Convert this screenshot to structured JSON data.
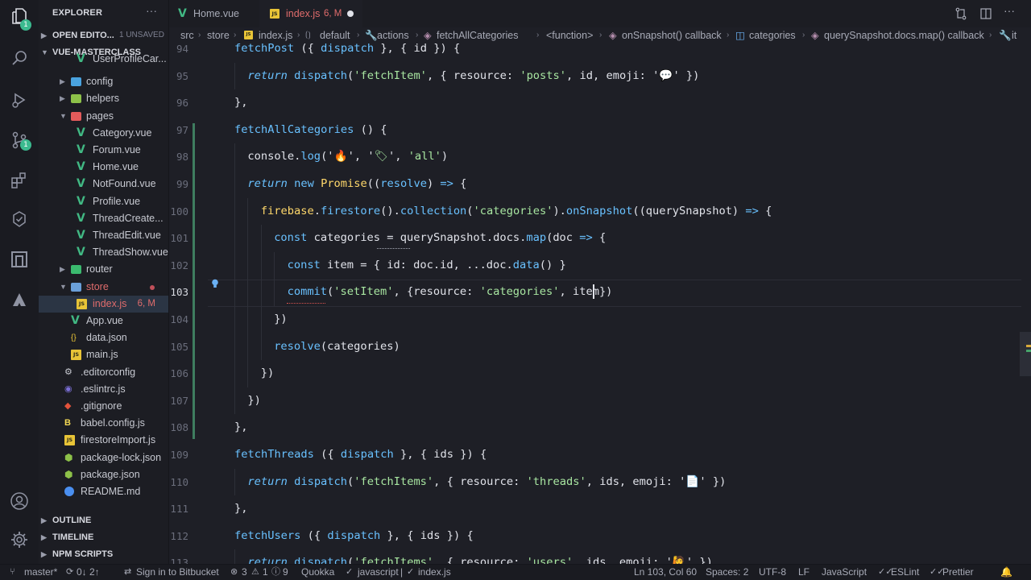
{
  "activity_bar": {
    "explorer_badge": "1",
    "scm_badge": "1"
  },
  "sidebar": {
    "title": "EXPLORER",
    "more": "···",
    "open_editors": {
      "label": "OPEN EDITO...",
      "status": "1 UNSAVED"
    },
    "project": {
      "label": "VUE-MASTERCLASS"
    },
    "tree": [
      {
        "label": "UserProfileCar...",
        "kind": "vue"
      },
      {
        "label": "config",
        "kind": "folder",
        "color": "#4aa3df"
      },
      {
        "label": "helpers",
        "kind": "folder",
        "color": "#8dc149"
      },
      {
        "label": "pages",
        "kind": "folder-open",
        "color": "#e35b5b"
      },
      {
        "label": "Category.vue",
        "kind": "vue"
      },
      {
        "label": "Forum.vue",
        "kind": "vue"
      },
      {
        "label": "Home.vue",
        "kind": "vue"
      },
      {
        "label": "NotFound.vue",
        "kind": "vue"
      },
      {
        "label": "Profile.vue",
        "kind": "vue"
      },
      {
        "label": "ThreadCreate...",
        "kind": "vue"
      },
      {
        "label": "ThreadEdit.vue",
        "kind": "vue"
      },
      {
        "label": "ThreadShow.vue",
        "kind": "vue"
      },
      {
        "label": "router",
        "kind": "folder",
        "color": "#3bba6f"
      },
      {
        "label": "store",
        "kind": "folder-open",
        "color": "#6a9fd8"
      },
      {
        "label": "index.js",
        "kind": "js",
        "status": "6, M"
      },
      {
        "label": "App.vue",
        "kind": "vue"
      },
      {
        "label": "data.json",
        "kind": "json"
      },
      {
        "label": "main.js",
        "kind": "js"
      },
      {
        "label": ".editorconfig",
        "kind": "config"
      },
      {
        "label": ".eslintrc.js",
        "kind": "eslint"
      },
      {
        "label": ".gitignore",
        "kind": "git"
      },
      {
        "label": "babel.config.js",
        "kind": "babel"
      },
      {
        "label": "firestoreImport.js",
        "kind": "js"
      },
      {
        "label": "package-lock.json",
        "kind": "npm"
      },
      {
        "label": "package.json",
        "kind": "npm"
      },
      {
        "label": "README.md",
        "kind": "info"
      }
    ],
    "sections": [
      {
        "label": "OUTLINE"
      },
      {
        "label": "TIMELINE"
      },
      {
        "label": "NPM SCRIPTS"
      }
    ]
  },
  "tabs": [
    {
      "label": "Home.vue",
      "icon": "vue"
    },
    {
      "label": "index.js",
      "icon": "js",
      "status": "6, M"
    }
  ],
  "breadcrumb": [
    "src",
    "store",
    "index.js",
    "default",
    "actions",
    "fetchAllCategories",
    "<function>",
    "onSnapshot() callback",
    "categories",
    "querySnapshot.docs.map() callback",
    "it"
  ],
  "editor": {
    "current_line": 103,
    "lines": [
      {
        "n": 94,
        "indent": 0,
        "tokens": [
          [
            "fn",
            "fetchPost"
          ],
          [
            "",
            " ({ "
          ],
          [
            "kw",
            "dispatch"
          ],
          [
            "",
            " }, { "
          ],
          [
            "prop",
            "id"
          ],
          [
            "",
            " }) {"
          ]
        ]
      },
      {
        "n": 95,
        "indent": 1,
        "tokens": [
          [
            "kwi",
            "return"
          ],
          [
            "",
            " "
          ],
          [
            "fn",
            "dispatch"
          ],
          [
            "",
            "("
          ],
          [
            "str",
            "'fetchItem'"
          ],
          [
            "",
            ", { "
          ],
          [
            "prop",
            "resource"
          ],
          [
            "",
            ": "
          ],
          [
            "str",
            "'posts'"
          ],
          [
            "",
            ", id, emoji: '"
          ],
          [
            "str",
            "💬"
          ],
          [
            "",
            "' })"
          ]
        ]
      },
      {
        "n": 96,
        "indent": 0,
        "tokens": [
          [
            "",
            "},"
          ]
        ]
      },
      {
        "n": 97,
        "indent": 0,
        "tokens": [
          [
            "fn",
            "fetchAllCategories"
          ],
          [
            "",
            " () {"
          ]
        ]
      },
      {
        "n": 98,
        "indent": 1,
        "tokens": [
          [
            "",
            "console."
          ],
          [
            "fn",
            "log"
          ],
          [
            "",
            "('"
          ],
          [
            "str",
            "🔥"
          ],
          [
            "",
            "', '"
          ],
          [
            "str",
            "🏷"
          ],
          [
            "",
            "', "
          ],
          [
            "str",
            "'all'"
          ],
          [
            "",
            ")"
          ]
        ]
      },
      {
        "n": 99,
        "indent": 1,
        "tokens": [
          [
            "kwi",
            "return"
          ],
          [
            "",
            " "
          ],
          [
            "kw",
            "new"
          ],
          [
            "",
            " "
          ],
          [
            "cls",
            "Promise"
          ],
          [
            "",
            "(("
          ],
          [
            "kw",
            "resolve"
          ],
          [
            "",
            ") "
          ],
          [
            "kw",
            "=>"
          ],
          [
            "",
            " {"
          ]
        ]
      },
      {
        "n": 100,
        "indent": 2,
        "tokens": [
          [
            "cls",
            "firebase"
          ],
          [
            "",
            "."
          ],
          [
            "fn",
            "firestore"
          ],
          [
            "",
            "()."
          ],
          [
            "fn",
            "collection"
          ],
          [
            "",
            "("
          ],
          [
            "str",
            "'categories'"
          ],
          [
            "",
            ")."
          ],
          [
            "fn",
            "onSnapshot"
          ],
          [
            "",
            "((querySnapshot) "
          ],
          [
            "kw",
            "=>"
          ],
          [
            "",
            " {"
          ]
        ]
      },
      {
        "n": 101,
        "indent": 3,
        "tokens": [
          [
            "kw",
            "const"
          ],
          [
            "",
            " categories = querySnapshot.docs."
          ],
          [
            "fn",
            "map"
          ],
          [
            "",
            "(doc "
          ],
          [
            "kw",
            "=>"
          ],
          [
            "",
            " {"
          ]
        ]
      },
      {
        "n": 102,
        "indent": 4,
        "tokens": [
          [
            "kw",
            "const"
          ],
          [
            "",
            " item = { id: doc.id, ...doc."
          ],
          [
            "fn",
            "data"
          ],
          [
            "",
            "() }"
          ]
        ]
      },
      {
        "n": 103,
        "indent": 4,
        "tokens": [
          [
            "fn",
            "commit"
          ],
          [
            "",
            "("
          ],
          [
            "str",
            "'setItem'"
          ],
          [
            "",
            ", {resource: "
          ],
          [
            "str",
            "'categories'"
          ],
          [
            "",
            ", item})"
          ]
        ]
      },
      {
        "n": 104,
        "indent": 3,
        "tokens": [
          [
            "",
            "})"
          ]
        ]
      },
      {
        "n": 105,
        "indent": 3,
        "tokens": [
          [
            "fn",
            "resolve"
          ],
          [
            "",
            "(categories)"
          ]
        ]
      },
      {
        "n": 106,
        "indent": 2,
        "tokens": [
          [
            "",
            "})"
          ]
        ]
      },
      {
        "n": 107,
        "indent": 1,
        "tokens": [
          [
            "",
            "})"
          ]
        ]
      },
      {
        "n": 108,
        "indent": 0,
        "tokens": [
          [
            "",
            "},"
          ]
        ]
      },
      {
        "n": 109,
        "indent": 0,
        "tokens": [
          [
            "fn",
            "fetchThreads"
          ],
          [
            "",
            " ({ "
          ],
          [
            "kw",
            "dispatch"
          ],
          [
            "",
            " }, { "
          ],
          [
            "prop",
            "ids"
          ],
          [
            "",
            " }) {"
          ]
        ]
      },
      {
        "n": 110,
        "indent": 1,
        "tokens": [
          [
            "kwi",
            "return"
          ],
          [
            "",
            " "
          ],
          [
            "fn",
            "dispatch"
          ],
          [
            "",
            "("
          ],
          [
            "str",
            "'fetchItems'"
          ],
          [
            "",
            ", { "
          ],
          [
            "prop",
            "resource"
          ],
          [
            "",
            ": "
          ],
          [
            "str",
            "'threads'"
          ],
          [
            "",
            ", ids, emoji: '"
          ],
          [
            "str",
            "📄"
          ],
          [
            "",
            "' })"
          ]
        ]
      },
      {
        "n": 111,
        "indent": 0,
        "tokens": [
          [
            "",
            "},"
          ]
        ]
      },
      {
        "n": 112,
        "indent": 0,
        "tokens": [
          [
            "fn",
            "fetchUsers"
          ],
          [
            "",
            " ({ "
          ],
          [
            "kw",
            "dispatch"
          ],
          [
            "",
            " }, { "
          ],
          [
            "prop",
            "ids"
          ],
          [
            "",
            " }) {"
          ]
        ]
      },
      {
        "n": 113,
        "indent": 1,
        "tokens": [
          [
            "kwi",
            "return"
          ],
          [
            "",
            " "
          ],
          [
            "fn",
            "dispatch"
          ],
          [
            "",
            "("
          ],
          [
            "str",
            "'fetchItems'"
          ],
          [
            "",
            ", { "
          ],
          [
            "prop",
            "resource"
          ],
          [
            "",
            ": "
          ],
          [
            "str",
            "'users'"
          ],
          [
            "",
            ", ids, emoji: '"
          ],
          [
            "str",
            "🙋"
          ],
          [
            "",
            "' })"
          ]
        ]
      }
    ]
  },
  "statusbar": {
    "branch": "master*",
    "sync": "0↓ 2↑",
    "bitbucket": "Sign in to Bitbucket",
    "errors": "3",
    "warnings": "1",
    "infos": "9",
    "quokka": "Quokka",
    "lang_path": "javascript",
    "file_path": "index.js",
    "position": "Ln 103, Col 60",
    "spaces": "Spaces: 2",
    "encoding": "UTF-8",
    "eol": "LF",
    "language": "JavaScript",
    "eslint": "ESLint",
    "prettier": "Prettier"
  },
  "colors": {
    "accent_green": "#41b883",
    "js_yellow": "#e8c437",
    "modified_red": "#e06c6c"
  }
}
